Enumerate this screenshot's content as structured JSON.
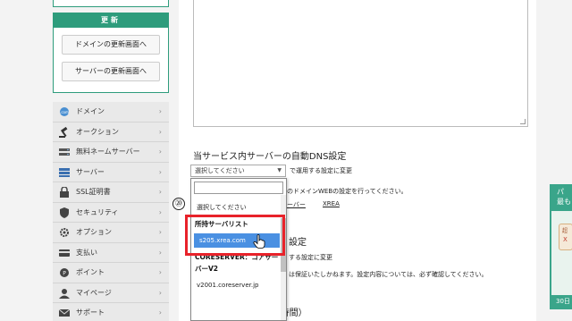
{
  "sidebar": {
    "update": {
      "header": "更新",
      "domain_button": "ドメインの更新画面へ",
      "server_button": "サーバーの更新画面へ"
    },
    "menu": [
      {
        "label": "ドメイン",
        "icon": "dotcom-icon"
      },
      {
        "label": "オークション",
        "icon": "gavel-icon"
      },
      {
        "label": "無料ネームサーバー",
        "icon": "nameserver-icon"
      },
      {
        "label": "サーバー",
        "icon": "server-icon"
      },
      {
        "label": "SSL証明書",
        "icon": "ssl-lock-icon"
      },
      {
        "label": "セキュリティ",
        "icon": "shield-icon"
      },
      {
        "label": "オプション",
        "icon": "gear-icon"
      },
      {
        "label": "支払い",
        "icon": "card-icon"
      },
      {
        "label": "ポイント",
        "icon": "point-icon"
      },
      {
        "label": "マイページ",
        "icon": "user-icon"
      },
      {
        "label": "サポート",
        "icon": "mail-icon"
      }
    ]
  },
  "main": {
    "dns_section": {
      "title": "当サービス内サーバーの自動DNS設定",
      "select_value": "選択してください",
      "select_suffix": "で運用する設定に変更",
      "web_note": "のドメインWEBの設定を行ってください。",
      "link_server": "ーバー",
      "link_xrea": "XREA"
    },
    "second_section": {
      "title_suffix": "設定",
      "line1": "する設定に変更",
      "line2": "は保証いたしかねます。設定内容については、必ず確認してください。"
    },
    "ttl_title": "TTL（キャッシュする時間）"
  },
  "dropdown": {
    "placeholder_option": "選択してください",
    "group_1": "所持サーバリスト",
    "selected_option": "s205.xrea.com",
    "group_2_line1": "CORESERVER：コアサー",
    "group_2_line2": "バーV2",
    "option_coreserver": "v2001.coreserver.jp"
  },
  "annotation": {
    "step_number": "⑳"
  },
  "side_ad": {
    "head_1": "パ",
    "head_2": "最も",
    "badge_top": "超",
    "badge_bottom": "X",
    "foot": "30日"
  },
  "colors": {
    "accent_green": "#2e9c7c",
    "highlight_red": "#e8222a",
    "selected_blue": "#4a90e2"
  }
}
